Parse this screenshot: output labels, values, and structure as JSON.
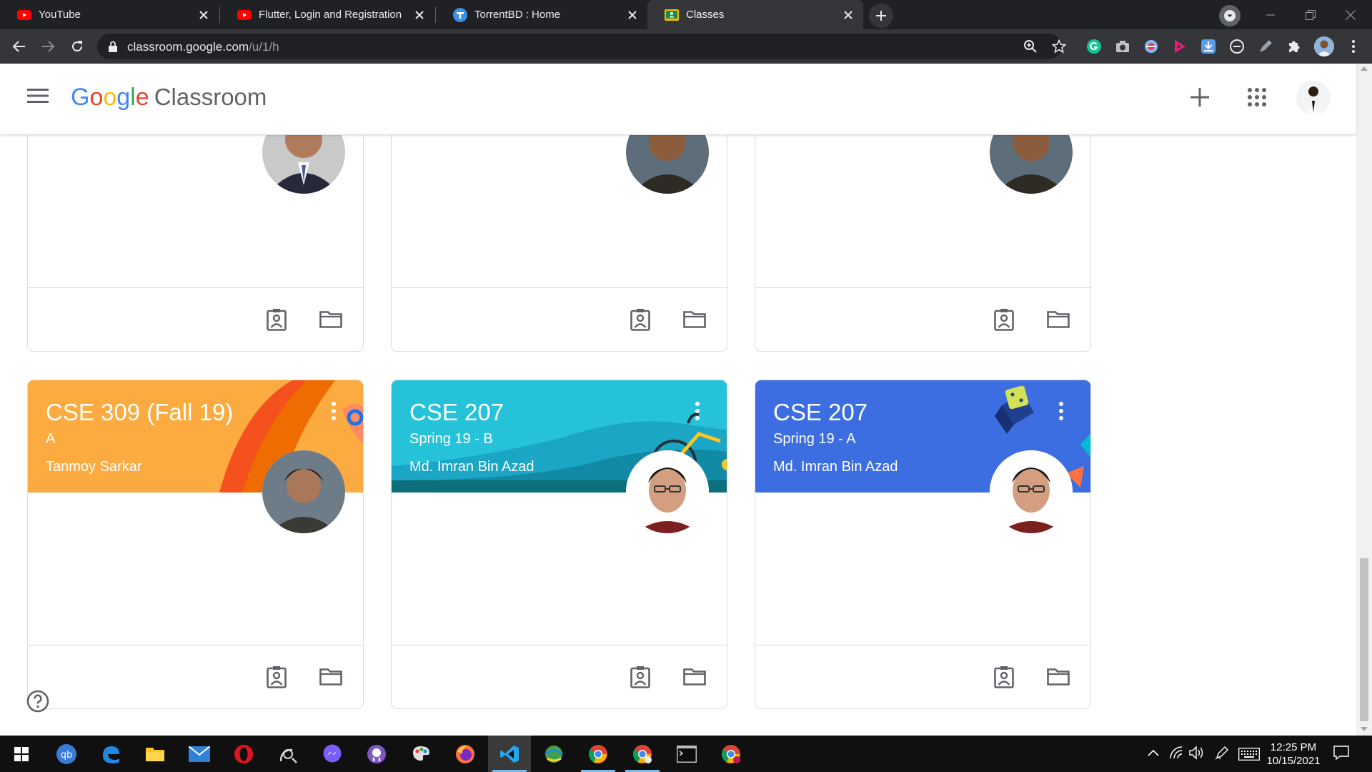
{
  "browser": {
    "tabs": [
      {
        "title": "YouTube",
        "icon": "youtube-icon"
      },
      {
        "title": "Flutter, Login and Registration us",
        "icon": "youtube-icon"
      },
      {
        "title": "TorrentBD : Home",
        "icon": "torrentbd-icon"
      },
      {
        "title": "Classes",
        "icon": "classroom-icon",
        "active": true
      }
    ],
    "url_host": "classroom.google.com",
    "url_path": "/u/1/h"
  },
  "app": {
    "brand_letters": [
      "G",
      "o",
      "o",
      "g",
      "l",
      "e"
    ],
    "product": "Classroom"
  },
  "classes_top": [
    {
      "photo": "teacher-photo-suit"
    },
    {
      "photo": "teacher-photo"
    },
    {
      "photo": "teacher-photo"
    }
  ],
  "classes": [
    {
      "title": "CSE 309 (Fall 19)",
      "section": "A",
      "teacher": "Tanmoy Sarkar",
      "color": "#fbab3f"
    },
    {
      "title": "CSE 207",
      "section": "Spring 19 - B",
      "teacher": "Md. Imran Bin Azad",
      "color": "#25c2d9"
    },
    {
      "title": "CSE 207",
      "section": "Spring 19 - A",
      "teacher": "Md. Imran Bin Azad",
      "color": "#3c6ee1"
    }
  ],
  "taskbar": {
    "time": "12:25 PM",
    "date": "10/15/2021"
  }
}
